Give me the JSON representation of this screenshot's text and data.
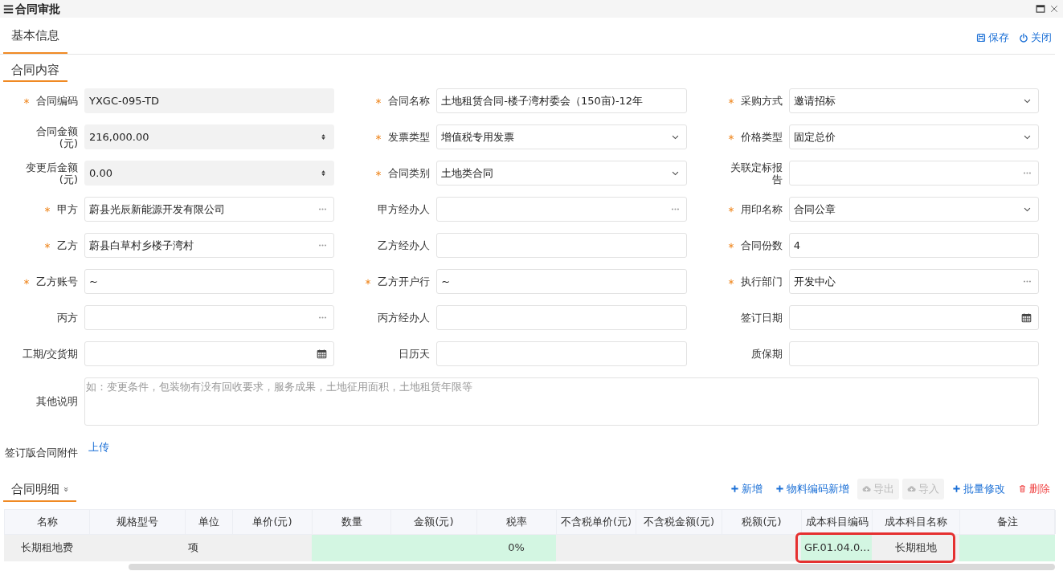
{
  "window": {
    "title": "合同审批"
  },
  "tabs": [
    {
      "label": "基本信息",
      "selected": true
    }
  ],
  "header_actions": [
    {
      "kind": "save",
      "label": "保存"
    },
    {
      "kind": "close",
      "label": "关闭"
    }
  ],
  "section": {
    "title": "合同内容"
  },
  "fields": [
    {
      "label": "合同编码",
      "required": true,
      "kind": "readonly",
      "value": "YXGC-095-TD"
    },
    {
      "label": "合同名称",
      "required": true,
      "kind": "text",
      "value": "土地租赁合同-楼子湾村委会（150亩)-12年"
    },
    {
      "label": "采购方式",
      "required": true,
      "kind": "select",
      "value": "邀请招标"
    },
    {
      "label": "合同金额(元)",
      "required": false,
      "kind": "number",
      "value": "216,000.00"
    },
    {
      "label": "发票类型",
      "required": true,
      "kind": "select",
      "value": "增值税专用发票"
    },
    {
      "label": "价格类型",
      "required": true,
      "kind": "select",
      "value": "固定总价"
    },
    {
      "label": "变更后金额(元)",
      "required": false,
      "kind": "number",
      "value": "0.00"
    },
    {
      "label": "合同类别",
      "required": true,
      "kind": "select",
      "value": "土地类合同"
    },
    {
      "label": "关联定标报告",
      "required": false,
      "kind": "lookup"
    },
    {
      "label": "甲方",
      "required": true,
      "kind": "lookup",
      "value": "蔚县光辰新能源开发有限公司"
    },
    {
      "label": "甲方经办人",
      "required": false,
      "kind": "lookup"
    },
    {
      "label": "用印名称",
      "required": true,
      "kind": "select",
      "value": "合同公章"
    },
    {
      "label": "乙方",
      "required": true,
      "kind": "lookup",
      "value": "蔚县白草村乡楼子湾村"
    },
    {
      "label": "乙方经办人",
      "required": false,
      "kind": "text"
    },
    {
      "label": "合同份数",
      "required": true,
      "kind": "text",
      "value": "4"
    },
    {
      "label": "乙方账号",
      "required": true,
      "kind": "text",
      "value": "~"
    },
    {
      "label": "乙方开户行",
      "required": true,
      "kind": "text",
      "value": "~"
    },
    {
      "label": "执行部门",
      "required": true,
      "kind": "lookup",
      "value": "开发中心"
    },
    {
      "label": "丙方",
      "required": false,
      "kind": "lookup"
    },
    {
      "label": "丙方经办人",
      "required": false,
      "kind": "text"
    },
    {
      "label": "签订日期",
      "required": false,
      "kind": "date"
    },
    {
      "label": "工期/交货期",
      "required": false,
      "kind": "date"
    },
    {
      "label": "日历天",
      "required": false,
      "kind": "text"
    },
    {
      "label": "质保期",
      "required": false,
      "kind": "text"
    }
  ],
  "remarks": {
    "label": "其他说明",
    "placeholder": "如：变更条件，包装物有没有回收要求，服务成果，土地征用面积，土地租赁年限等"
  },
  "attachment": {
    "label": "签订版合同附件",
    "link": "上传"
  },
  "details": {
    "title": "合同明细",
    "expand_icon": "»",
    "toolbar": [
      {
        "kind": "add",
        "label": "新增",
        "disabled": false
      },
      {
        "kind": "add",
        "label": "物料编码新增",
        "disabled": false
      },
      {
        "kind": "export",
        "label": "导出",
        "disabled": true
      },
      {
        "kind": "import",
        "label": "导入",
        "disabled": true
      },
      {
        "kind": "add",
        "label": "批量修改",
        "disabled": false
      },
      {
        "kind": "delete",
        "label": "删除",
        "disabled": false
      }
    ],
    "columns": [
      {
        "label": "名称",
        "highlighted": false
      },
      {
        "label": "规格型号",
        "highlighted": false
      },
      {
        "label": "单位",
        "highlighted": false
      },
      {
        "label": "单价(元)",
        "highlighted": false
      },
      {
        "label": "数量",
        "highlighted": false
      },
      {
        "label": "金额(元)",
        "highlighted": false
      },
      {
        "label": "税率",
        "highlighted": false
      },
      {
        "label": "不含税单价(元)",
        "highlighted": false
      },
      {
        "label": "不含税金额(元)",
        "highlighted": false
      },
      {
        "label": "税额(元)",
        "highlighted": false
      },
      {
        "label": "成本科目编码",
        "highlighted": true
      },
      {
        "label": "成本科目名称",
        "highlighted": true
      },
      {
        "label": "备注",
        "highlighted": false
      }
    ],
    "rows": [
      {
        "cells": [
          {
            "value": "长期租地费",
            "editable": false
          },
          {
            "editable": false
          },
          {
            "value": "项",
            "editable": false
          },
          {
            "editable": false
          },
          {
            "editable": true
          },
          {
            "editable": true
          },
          {
            "value": "0%",
            "editable": true
          },
          {
            "editable": false
          },
          {
            "editable": false
          },
          {
            "editable": false
          },
          {
            "value": "GF.01.04.0...",
            "editable": true
          },
          {
            "value": "长期租地",
            "editable": false
          },
          {
            "editable": true
          }
        ]
      }
    ]
  }
}
